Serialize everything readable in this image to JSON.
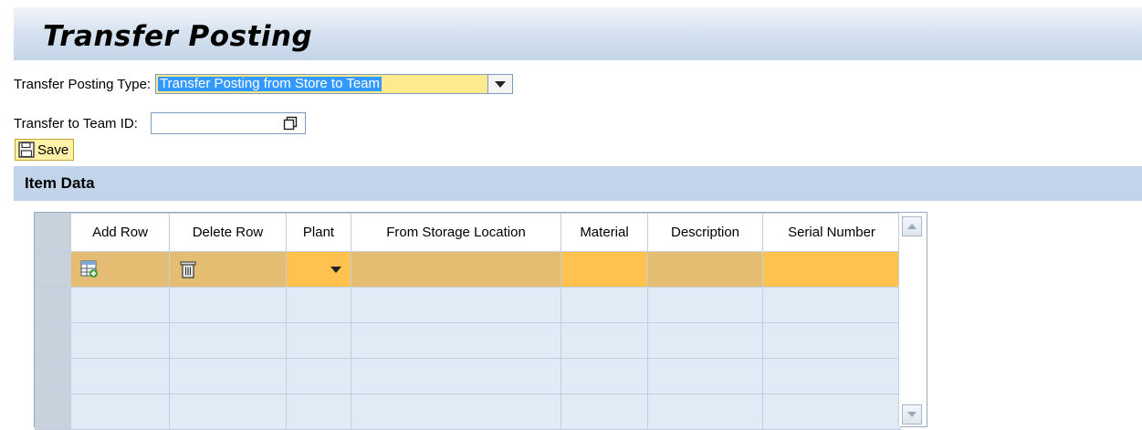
{
  "page": {
    "title": "Transfer Posting"
  },
  "form": {
    "type_label": "Transfer Posting Type:",
    "type_value": "Transfer Posting from Store to Team",
    "team_label": "Transfer to Team ID:",
    "team_value": ""
  },
  "toolbar": {
    "save_label": "Save",
    "save_icon": "floppy-disk-icon"
  },
  "section": {
    "title": "Item Data"
  },
  "table": {
    "columns": [
      "Add Row",
      "Delete Row",
      "Plant",
      "From Storage Location",
      "Material",
      "Description",
      "Serial Number"
    ],
    "row_icons": {
      "add_row": "add-row-icon",
      "delete_row": "trash-icon",
      "plant": "chevron-down-icon"
    },
    "rows": [
      [
        "",
        "",
        "",
        "",
        "",
        "",
        ""
      ],
      [
        "",
        "",
        "",
        "",
        "",
        "",
        ""
      ],
      [
        "",
        "",
        "",
        "",
        "",
        "",
        ""
      ],
      [
        "",
        "",
        "",
        "",
        "",
        "",
        ""
      ],
      [
        "",
        "",
        "",
        "",
        "",
        "",
        ""
      ]
    ]
  },
  "colors": {
    "title_bar": "#c3d4e8",
    "section_bar": "#c2d4e9",
    "active_row": "#e4bd72",
    "active_row_highlight": "#ffc24e",
    "empty_row": "#e1ebf5",
    "dropdown_field": "#ffe98f",
    "selection": "#3399ff"
  }
}
